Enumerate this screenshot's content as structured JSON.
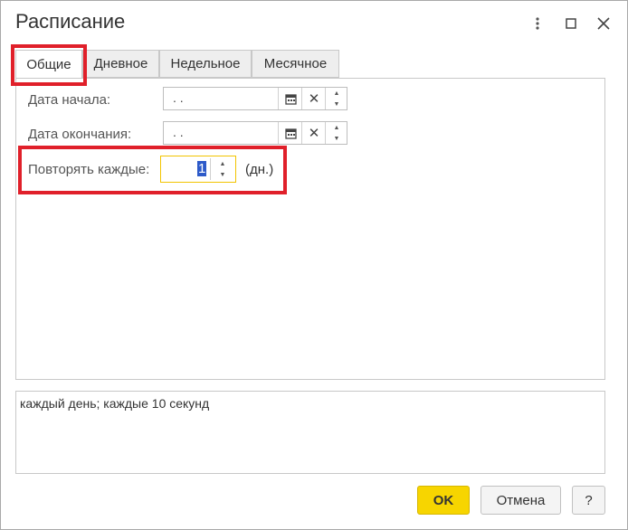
{
  "window": {
    "title": "Расписание"
  },
  "tabs": [
    {
      "label": "Общие",
      "active": true
    },
    {
      "label": "Дневное",
      "active": false
    },
    {
      "label": "Недельное",
      "active": false
    },
    {
      "label": "Месячное",
      "active": false
    }
  ],
  "general": {
    "start_date_label": "Дата начала:",
    "start_date_value": " .  .",
    "end_date_label": "Дата окончания:",
    "end_date_value": " .  .",
    "repeat_label": "Повторять каждые:",
    "repeat_value": "1",
    "repeat_unit": "(дн.)"
  },
  "description": {
    "text": "каждый день; каждые 10 секунд"
  },
  "buttons": {
    "ok": "OK",
    "cancel": "Отмена",
    "help": "?"
  },
  "colors": {
    "accent": "#f7d500",
    "focus_border": "#f2c400",
    "highlight_box": "#e0202a"
  }
}
